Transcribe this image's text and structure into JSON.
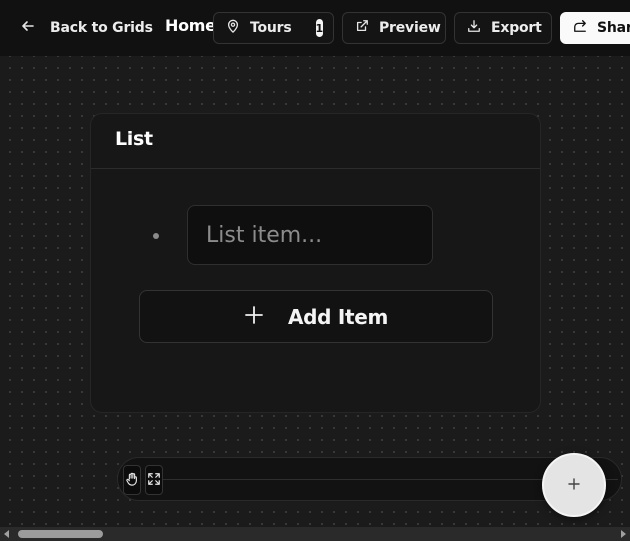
{
  "header": {
    "back_label": "Back to Grids",
    "page_title": "Home",
    "tours_label": "Tours",
    "tours_count": "1",
    "preview_label": "Preview",
    "export_label": "Export",
    "share_label": "Share"
  },
  "list_card": {
    "title": "List",
    "item_placeholder": "List item...",
    "item_value": "",
    "add_label": "Add Item"
  },
  "icons": {
    "back": "arrow-left-icon",
    "tours": "map-pin-icon",
    "preview": "external-link-icon",
    "export": "download-icon",
    "share": "share-icon",
    "add": "plus-icon",
    "hand": "hand-icon",
    "expand": "expand-icon",
    "fab": "plus-icon"
  },
  "colors": {
    "canvas": "#1b1b1b",
    "topbar": "#111111",
    "card": "#171717",
    "share_button": "#fafafa",
    "fab": "#e4e4e4"
  }
}
